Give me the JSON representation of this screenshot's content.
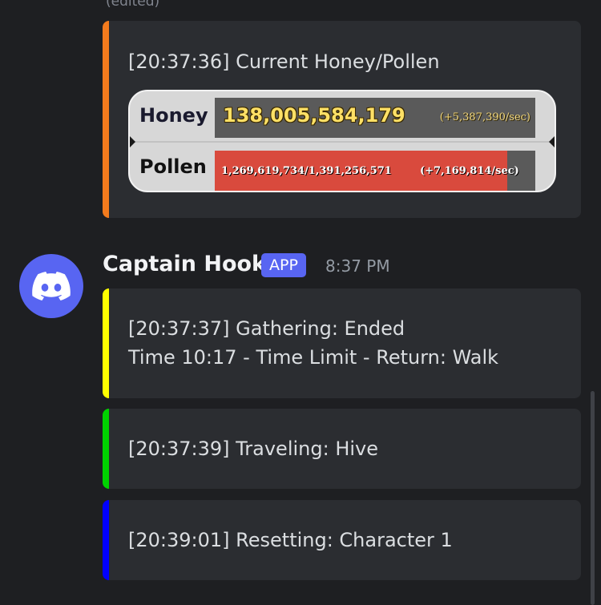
{
  "prior_message": {
    "edited_label": "(edited)",
    "embed": {
      "accent_color": "#f37b1d",
      "text": "[20:37:36] Current Honey/Pollen",
      "game_widget": {
        "honey_label": "Honey",
        "honey_amount": "138,005,584,179",
        "honey_rate": "(+5,387,390/sec)",
        "pollen_label": "Pollen",
        "pollen_amount": "1,269,619,734/1,391,256,571",
        "pollen_rate": "(+7,169,814/sec)",
        "pollen_fill_fraction": 0.9126
      }
    }
  },
  "message": {
    "author": "Captain Hook",
    "badge": "APP",
    "timestamp": "8:37 PM",
    "avatar_icon": "discord-logo-icon",
    "avatar_color": "#5865f2",
    "embeds": [
      {
        "accent_color": "#ffff00",
        "line1": "[20:37:37] Gathering: Ended",
        "line2": "Time 10:17 - Time Limit - Return: Walk"
      },
      {
        "accent_color": "#00d200",
        "line1": "[20:37:39] Traveling: Hive"
      },
      {
        "accent_color": "#0000ff",
        "line1": "[20:39:01] Resetting: Character 1"
      }
    ]
  }
}
